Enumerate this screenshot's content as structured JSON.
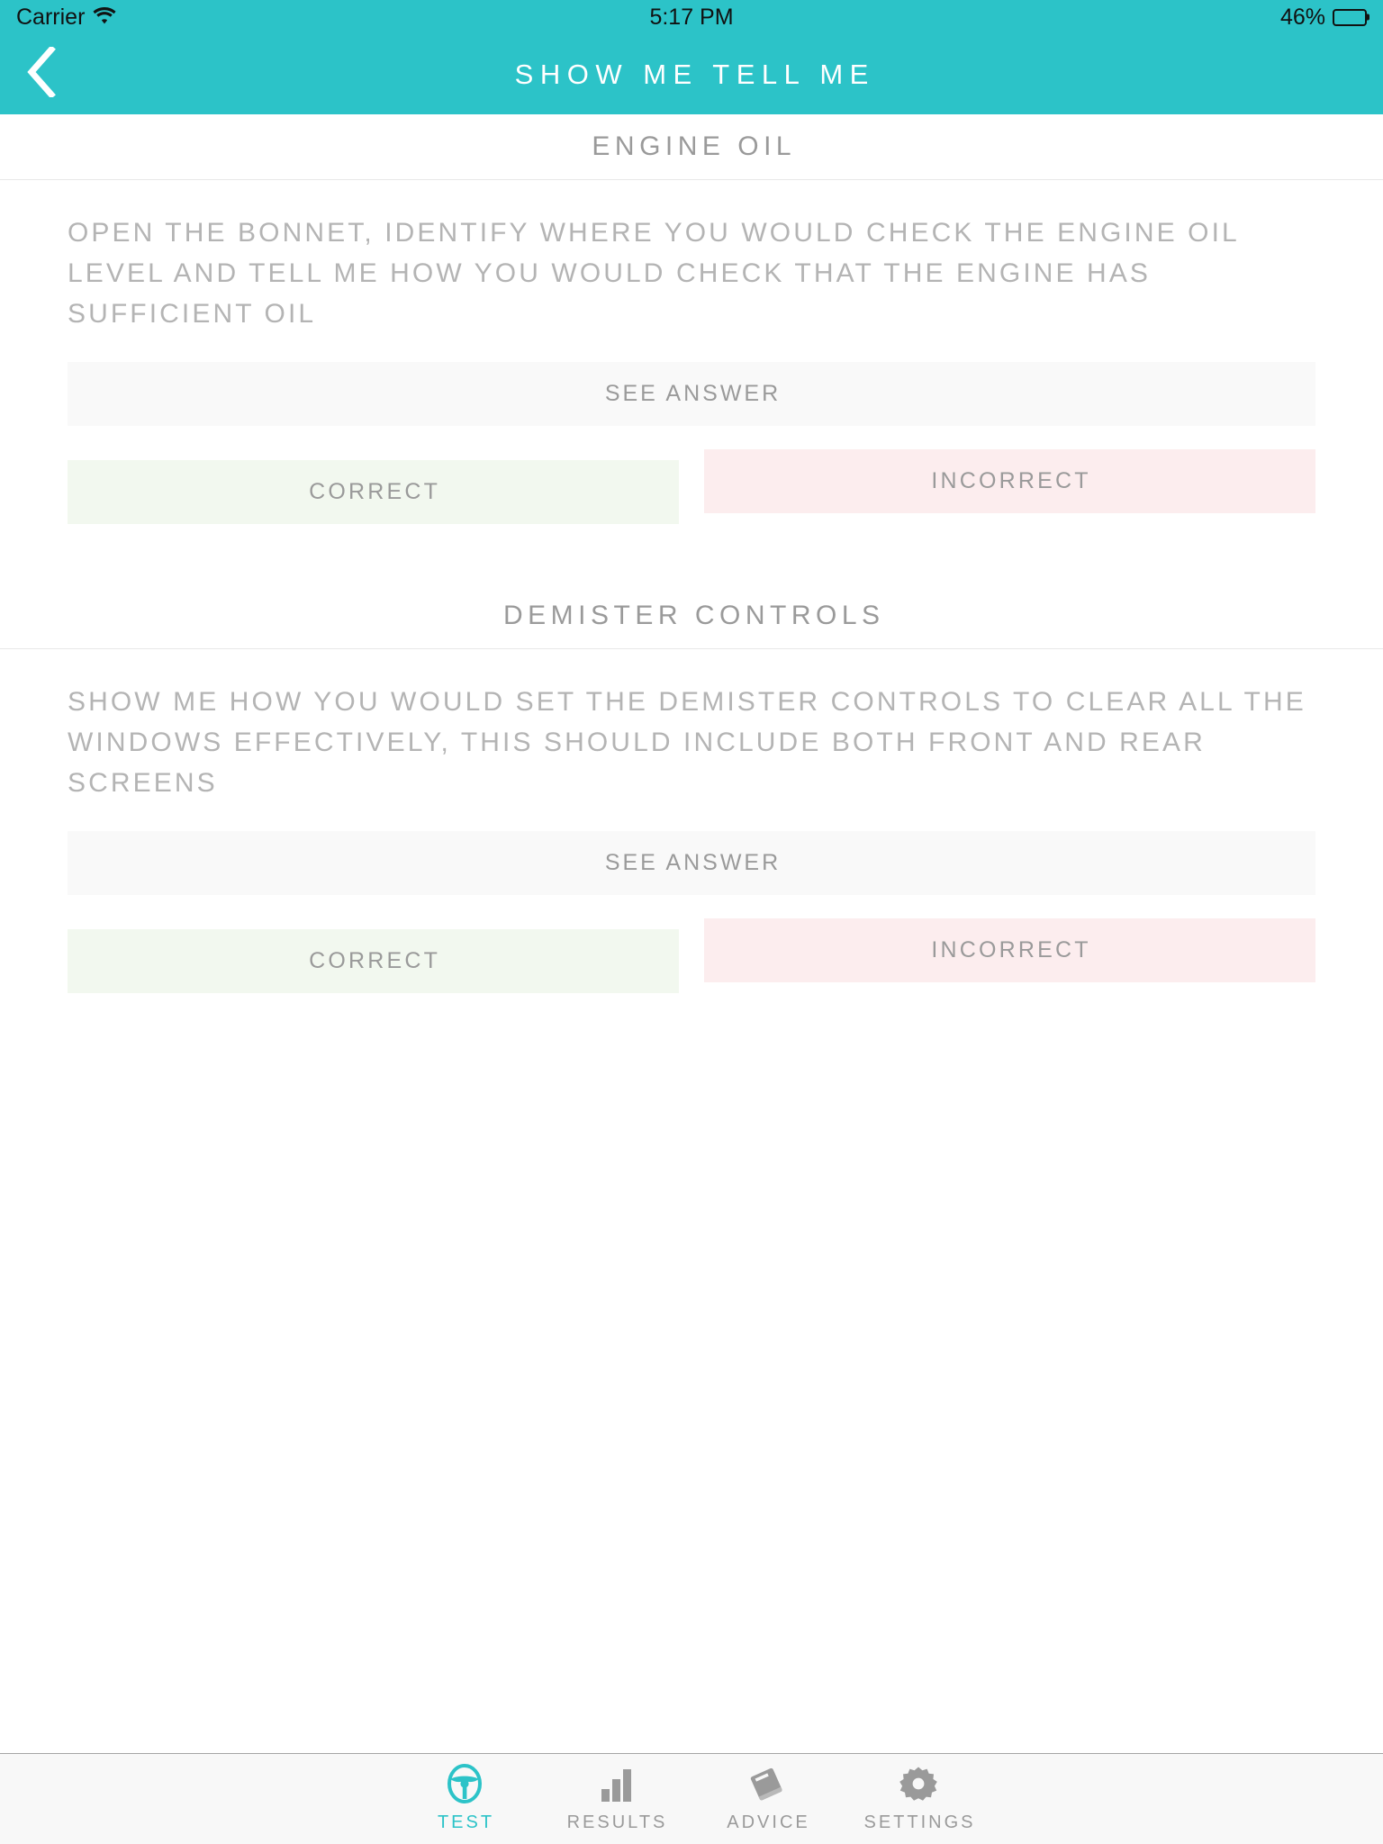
{
  "status_bar": {
    "carrier": "Carrier",
    "wifi_icon": "wifi-icon",
    "time": "5:17 PM",
    "battery_percent": "46%",
    "battery_level": 46
  },
  "nav": {
    "back_icon": "chevron-left-icon",
    "title": "SHOW ME TELL ME"
  },
  "colors": {
    "accent": "#2cc3c8",
    "correct_bg": "#f2f8ef",
    "incorrect_bg": "#fcedee",
    "see_answer_bg": "#f9f9f9",
    "text_gray": "#9a9a9a",
    "question_gray": "#b4b4b4"
  },
  "sections": [
    {
      "title": "ENGINE OIL",
      "question": "OPEN THE BONNET, IDENTIFY WHERE YOU WOULD CHECK THE ENGINE OIL LEVEL AND TELL ME HOW YOU WOULD CHECK THAT THE ENGINE HAS SUFFICIENT OIL",
      "see_answer_label": "SEE ANSWER",
      "correct_label": "CORRECT",
      "incorrect_label": "INCORRECT"
    },
    {
      "title": "DEMISTER CONTROLS",
      "question": "SHOW ME HOW YOU WOULD SET THE DEMISTER CONTROLS TO CLEAR ALL THE WINDOWS EFFECTIVELY, THIS SHOULD INCLUDE BOTH FRONT AND REAR SCREENS",
      "see_answer_label": "SEE ANSWER",
      "correct_label": "CORRECT",
      "incorrect_label": "INCORRECT"
    }
  ],
  "tab_bar": {
    "items": [
      {
        "label": "TEST",
        "icon": "steering-wheel-icon",
        "active": true
      },
      {
        "label": "RESULTS",
        "icon": "bar-chart-icon",
        "active": false
      },
      {
        "label": "ADVICE",
        "icon": "book-icon",
        "active": false
      },
      {
        "label": "SETTINGS",
        "icon": "gear-icon",
        "active": false
      }
    ]
  }
}
